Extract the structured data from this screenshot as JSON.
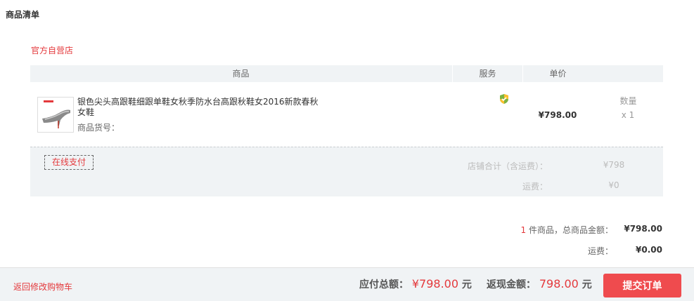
{
  "section": {
    "title": "商品清单"
  },
  "store": {
    "name": "官方自营店"
  },
  "table": {
    "headers": {
      "goods": "商品",
      "service": "服务",
      "price": "单价",
      "qty": "数量"
    }
  },
  "product": {
    "title": "银色尖头高跟鞋细跟单鞋女秋季防水台高跟秋鞋女2016新款春秋女鞋",
    "code_label": "商品货号：",
    "service_icon": "shield-icon",
    "unit_price": "¥798.00",
    "quantity": "x 1"
  },
  "store_footer": {
    "pay_method": "在线支付",
    "subtotal_label": "店铺合计（含运费）：",
    "subtotal_value": "¥798",
    "shipping_label": "运费：",
    "shipping_value": "¥0"
  },
  "summary": {
    "count": "1",
    "count_suffix": " 件商品，总商品金额：",
    "total_value": "¥798.00",
    "shipping_label": "运费：",
    "shipping_value": "¥0.00"
  },
  "bottom": {
    "back_link": "返回修改购物车",
    "payable_label": "应付总额：",
    "payable_amount": "¥798.00",
    "payable_unit": "元",
    "cashback_label": "返现金额：",
    "cashback_amount": "798.00",
    "cashback_unit": "元",
    "submit": "提交订单"
  },
  "colors": {
    "accent": "#e4393c",
    "button": "#ef4b4e",
    "panel": "#f0f3f5"
  }
}
